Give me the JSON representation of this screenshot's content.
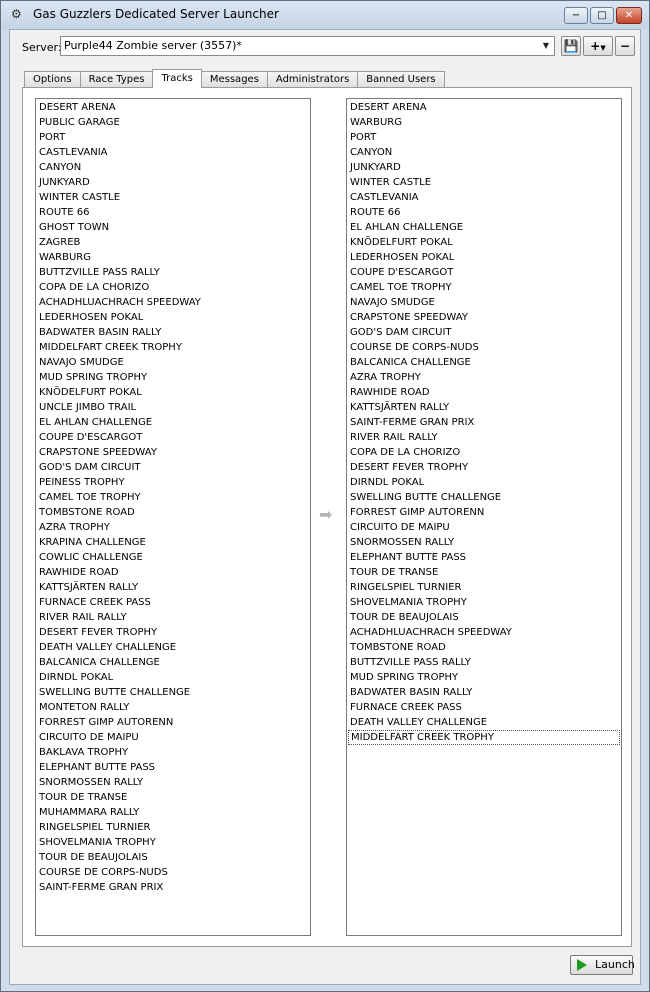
{
  "window": {
    "title": "Gas Guzzlers Dedicated Server Launcher",
    "controls": {
      "minimize": "−",
      "maximize": "□",
      "close": "✕"
    }
  },
  "server": {
    "label": "Server:",
    "selected": "Purple44 Zombie server (3557)*",
    "icons": {
      "save": "floppy-disk-icon",
      "add": "plus-icon",
      "remove": "minus-icon"
    }
  },
  "tabs": [
    {
      "label": "Options"
    },
    {
      "label": "Race Types"
    },
    {
      "label": "Tracks",
      "active": true
    },
    {
      "label": "Messages"
    },
    {
      "label": "Administrators"
    },
    {
      "label": "Banned Users"
    }
  ],
  "tracks_available": [
    "DESERT ARENA",
    "PUBLIC GARAGE",
    "PORT",
    "CASTLEVANIA",
    "CANYON",
    "JUNKYARD",
    "WINTER CASTLE",
    "ROUTE 66",
    "GHOST TOWN",
    "ZAGREB",
    "WARBURG",
    "BUTTZVILLE PASS RALLY",
    "COPA DE LA CHORIZO",
    "ACHADHLUACHRACH SPEEDWAY",
    "LEDERHOSEN POKAL",
    "BADWATER BASIN RALLY",
    "MIDDELFART CREEK TROPHY",
    "NAVAJO SMUDGE",
    "MUD SPRING TROPHY",
    "KNÖDELFURT POKAL",
    "UNCLE JIMBO TRAIL",
    "EL AHLAN CHALLENGE",
    "COUPE D'ESCARGOT",
    "CRAPSTONE SPEEDWAY",
    "GOD'S DAM CIRCUIT",
    "PEINESS TROPHY",
    "CAMEL TOE TROPHY",
    "TOMBSTONE ROAD",
    "AZRA TROPHY",
    "KRAPINA CHALLENGE",
    "COWLIC CHALLENGE",
    "RAWHIDE ROAD",
    "KATTSJÄRTEN RALLY",
    "FURNACE CREEK PASS",
    "RIVER RAIL RALLY",
    "DESERT FEVER TROPHY",
    "DEATH VALLEY CHALLENGE",
    "BALCANICA CHALLENGE",
    "DIRNDL POKAL",
    "SWELLING BUTTE CHALLENGE",
    "MONTETON RALLY",
    "FORREST GIMP AUTORENN",
    "CIRCUITO DE MAIPU",
    "BAKLAVA TROPHY",
    "ELEPHANT BUTTE PASS",
    "SNORMOSSEN RALLY",
    "TOUR DE TRANSE",
    "MUHAMMARA RALLY",
    "RINGELSPIEL TURNIER",
    "SHOVELMANIA TROPHY",
    "TOUR DE BEAUJOLAIS",
    "COURSE DE CORPS-NUDS",
    "SAINT-FERME GRAN PRIX"
  ],
  "tracks_selected": [
    "DESERT ARENA",
    "WARBURG",
    "PORT",
    "CANYON",
    "JUNKYARD",
    "WINTER CASTLE",
    "CASTLEVANIA",
    "ROUTE 66",
    "EL AHLAN CHALLENGE",
    "KNÖDELFURT POKAL",
    "LEDERHOSEN POKAL",
    "COUPE D'ESCARGOT",
    "CAMEL TOE TROPHY",
    "NAVAJO SMUDGE",
    "CRAPSTONE SPEEDWAY",
    "GOD'S DAM CIRCUIT",
    "COURSE DE CORPS-NUDS",
    "BALCANICA CHALLENGE",
    "AZRA TROPHY",
    "RAWHIDE ROAD",
    "KATTSJÄRTEN RALLY",
    "SAINT-FERME GRAN PRIX",
    "RIVER RAIL RALLY",
    "COPA DE LA CHORIZO",
    "DESERT FEVER TROPHY",
    "DIRNDL POKAL",
    "SWELLING BUTTE CHALLENGE",
    "FORREST GIMP AUTORENN",
    "CIRCUITO DE MAIPU",
    "SNORMOSSEN RALLY",
    "ELEPHANT BUTTE PASS",
    "TOUR DE TRANSE",
    "RINGELSPIEL TURNIER",
    "SHOVELMANIA TROPHY",
    "TOUR DE BEAUJOLAIS",
    "ACHADHLUACHRACH SPEEDWAY",
    "TOMBSTONE ROAD",
    "BUTTZVILLE PASS RALLY",
    "MUD SPRING TROPHY",
    "BADWATER BASIN RALLY",
    "FURNACE CREEK PASS",
    "DEATH VALLEY CHALLENGE",
    "MIDDELFART CREEK TROPHY"
  ],
  "focused_selected_index": 42,
  "transfer_icon": "arrow-right-icon",
  "footer": {
    "launch_label": "Launch",
    "launch_icon": "play-icon"
  },
  "colors": {
    "launch_icon": "#1f9a1f",
    "close_button": "#c4442a"
  }
}
